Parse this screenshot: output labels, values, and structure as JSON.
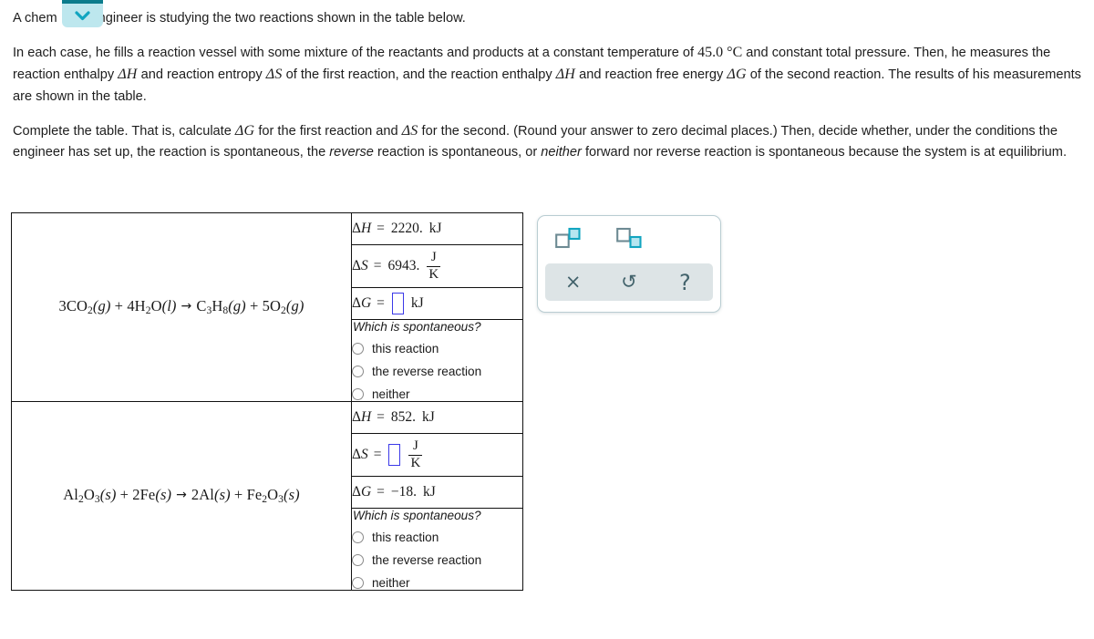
{
  "prose": {
    "p1": {
      "before": "A chem",
      "after": "ngineer is studying the two reactions shown in the table below."
    },
    "p2": {
      "s1": "In each case, he fills a reaction vessel with some mixture of the reactants and products at a constant temperature of ",
      "temperature": "45.0 °C",
      "s2": " and constant total pressure. Then, he measures the reaction enthalpy ",
      "dH1": "ΔH",
      "s3": " and reaction entropy ",
      "dS1": "ΔS",
      "s4": " of the first reaction, and the reaction enthalpy ",
      "dH2": "ΔH",
      "s5": " and reaction free energy ",
      "dG1": "ΔG",
      "s6": " of the second reaction. The results of his measurements are shown in the table."
    },
    "p3": {
      "s1": "Complete the table. That is, calculate ",
      "dG": "ΔG",
      "s2": " for the first reaction and ",
      "dS": "ΔS",
      "s3": " for the second. (Round your answer to zero decimal places.) Then, decide whether, under the conditions the engineer has set up, the reaction is spontaneous, the ",
      "em1": "reverse",
      "s4": " reaction is spontaneous, or ",
      "em2": "neither",
      "s5": " forward nor reverse reaction is spontaneous because the system is at equilibrium."
    }
  },
  "dropdown": {
    "icon": "chevron-down-icon",
    "fill_color": "#bde7ee",
    "bar_color": "#0b7c8c",
    "chevron_color": "#12a5c0"
  },
  "table": {
    "rows": [
      {
        "reaction": {
          "coef1": "3",
          "f1": "CO",
          "f1sub": "2",
          "f1state": "(g)",
          "plus1": " + ",
          "coef2": "4",
          "f2a": "H",
          "f2asub": "2",
          "f2b": "O",
          "f2state": "(l)",
          "arrow": "→",
          "coef3": "",
          "f3a": "C",
          "f3asub": "3",
          "f3b": "H",
          "f3bsub": "8",
          "f3state": "(g)",
          "plus2": " + ",
          "coef4": "5",
          "f4": "O",
          "f4sub": "2",
          "f4state": "(g)"
        },
        "enthalpy": {
          "symbol": "ΔH",
          "equals": "=",
          "value": "2220.",
          "unit": "kJ"
        },
        "entropy": {
          "symbol": "ΔS",
          "equals": "=",
          "value": "6943.",
          "unit_num": "J",
          "unit_den": "K",
          "is_input": false
        },
        "free_energy": {
          "symbol": "ΔG",
          "equals": "=",
          "value": "",
          "unit": "kJ",
          "is_input": true
        },
        "question": "Which is spontaneous?",
        "options": [
          "this reaction",
          "the reverse reaction",
          "neither"
        ],
        "selected": null
      },
      {
        "reaction": {
          "coef1": "",
          "f1a": "Al",
          "f1asub": "2",
          "f1b": "O",
          "f1bsub": "3",
          "f1state": "(s)",
          "plus1": " + ",
          "coef2": "2",
          "f2": "Fe",
          "f2state": "(s)",
          "arrow": "→",
          "coef3": "2",
          "f3": "Al",
          "f3state": "(s)",
          "plus2": " + ",
          "coef4": "",
          "f4a": "Fe",
          "f4asub": "2",
          "f4b": "O",
          "f4bsub": "3",
          "f4state": "(s)"
        },
        "enthalpy": {
          "symbol": "ΔH",
          "equals": "=",
          "value": "852.",
          "unit": "kJ"
        },
        "entropy": {
          "symbol": "ΔS",
          "equals": "=",
          "value": "",
          "unit_num": "J",
          "unit_den": "K",
          "is_input": true
        },
        "free_energy": {
          "symbol": "ΔG",
          "equals": "=",
          "value": "−18.",
          "unit": "kJ",
          "is_input": false
        },
        "question": "Which is spontaneous?",
        "options": [
          "this reaction",
          "the reverse reaction",
          "neither"
        ],
        "selected": null
      }
    ]
  },
  "toolbar": {
    "superscript": {
      "name": "superscript-icon",
      "accent": "#12a5c0",
      "outline": "#6d8a93"
    },
    "subscript": {
      "name": "subscript-icon",
      "accent": "#12a5c0",
      "outline": "#6d8a93"
    },
    "clear": {
      "name": "close-icon",
      "glyph": "×"
    },
    "undo": {
      "name": "undo-icon",
      "glyph": "↺"
    },
    "help": {
      "name": "help-icon",
      "glyph": "?"
    }
  }
}
